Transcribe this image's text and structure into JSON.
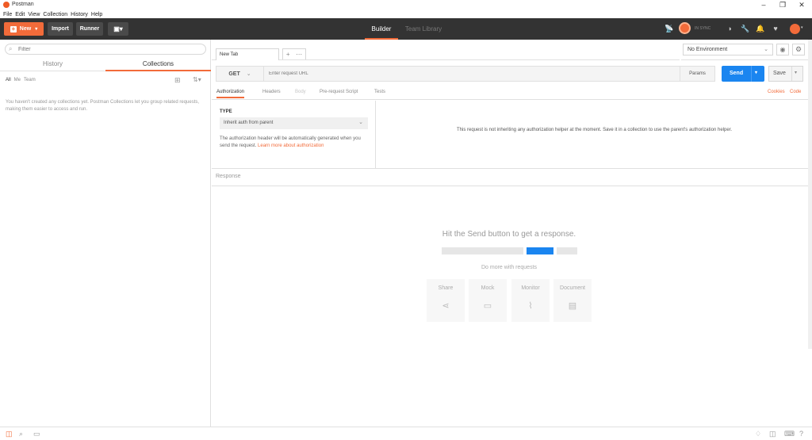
{
  "window": {
    "title": "Postman",
    "minimize": "–",
    "maximize": "❐",
    "close": "✕"
  },
  "menu": [
    "File",
    "Edit",
    "View",
    "Collection",
    "History",
    "Help"
  ],
  "toolbar": {
    "new_label": "New",
    "import_label": "Import",
    "runner_label": "Runner",
    "tabs": {
      "builder": "Builder",
      "team_library": "Team Library"
    },
    "sync_text": "IN SYNC"
  },
  "sidebar": {
    "filter_placeholder": "Filter",
    "tabs": {
      "history": "History",
      "collections": "Collections"
    },
    "scope": [
      "All",
      "Me",
      "Team"
    ],
    "empty_message": "You haven't created any collections yet. Postman Collections let you group related requests, making them easier to access and run."
  },
  "request": {
    "tab_label": "New Tab",
    "method": "GET",
    "url_placeholder": "Enter request URL",
    "params_label": "Params",
    "send_label": "Send",
    "save_label": "Save",
    "environment": "No Environment",
    "subtabs": {
      "authorization": "Authorization",
      "headers": "Headers",
      "body": "Body",
      "pre_request": "Pre-request Script",
      "tests": "Tests",
      "cookies": "Cookies",
      "code": "Code"
    },
    "auth": {
      "type_label": "TYPE",
      "type_value": "Inherit auth from parent",
      "description": "The authorization header will be automatically generated when you send the request.",
      "link": "Learn more about authorization",
      "right_message": "This request is not inheriting any authorization helper at the moment. Save it in a collection to use the parent's authorization helper."
    }
  },
  "response": {
    "label": "Response",
    "hint": "Hit the Send button to get a response.",
    "do_more": "Do more with requests",
    "cards": [
      "Share",
      "Mock",
      "Monitor",
      "Document"
    ]
  },
  "colors": {
    "accent": "#f26b3a",
    "send": "#1a85f0",
    "toolbar": "#333333"
  }
}
